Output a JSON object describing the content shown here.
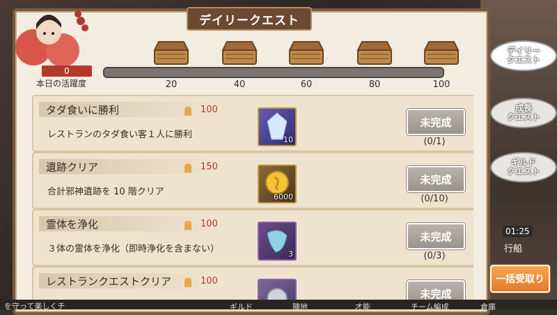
{
  "title": "デイリークエスト",
  "score": {
    "value": "0",
    "label": "本日の活躍度",
    "progress": 0
  },
  "milestones": [
    "20",
    "40",
    "60",
    "80",
    "100"
  ],
  "quests": [
    {
      "title": "タダ食いに勝利",
      "points": "100",
      "description": "レストランのタダ食い客１人に勝利",
      "reward_icon": "crystal-icon",
      "reward_count": "10",
      "button": "未完成",
      "progress": "(0/1)"
    },
    {
      "title": "遺跡クリア",
      "points": "150",
      "description": "合計邪神遺跡を 10 階クリア",
      "reward_icon": "gold-coin-icon",
      "reward_count": "6000",
      "button": "未完成",
      "progress": "(0/10)"
    },
    {
      "title": "霊体を浄化",
      "points": "100",
      "description": "３体の霊体を浄化（即時浄化を含まない）",
      "reward_icon": "spirit-stone-icon",
      "reward_count": "3",
      "button": "未完成",
      "progress": "(0/3)"
    },
    {
      "title": "レストランクエストクリア",
      "points": "100",
      "description": "",
      "reward_icon": "silver-item-icon",
      "reward_count": "",
      "button": "未完成",
      "progress": ""
    }
  ],
  "side_tabs": [
    {
      "label": "デイリー\nクエスト",
      "active": true
    },
    {
      "label": "成長\nクエスト",
      "active": false
    },
    {
      "label": "ギルド\nクエスト",
      "active": false
    }
  ],
  "claim_all": "一括受取り",
  "time": "01:25",
  "ship": "行船",
  "bottom": {
    "text": "を守って楽しくチ",
    "tabs": [
      "ギルド",
      "陣地",
      "才能",
      "チーム編成",
      "倉庫"
    ]
  },
  "colors": {
    "accent": "#b0372a",
    "panel": "#f3ece0",
    "button_disabled": "#a9a29a",
    "claim": "#f08f3a"
  }
}
